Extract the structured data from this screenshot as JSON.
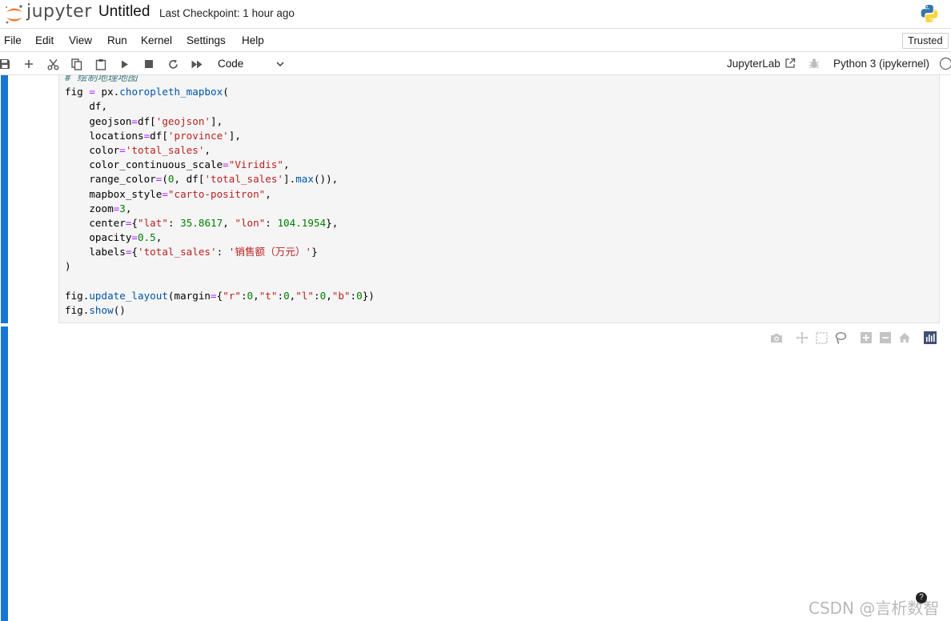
{
  "header": {
    "brand": "jupyter",
    "notebook_title": "Untitled",
    "checkpoint": "Last Checkpoint: 1 hour ago",
    "logo_icon": "jupyter-logo-icon",
    "kernel_logo_icon": "python-logo-icon"
  },
  "menubar": {
    "items": [
      "File",
      "Edit",
      "View",
      "Run",
      "Kernel",
      "Settings",
      "Help"
    ],
    "trusted": "Trusted"
  },
  "toolbar": {
    "icons": [
      "save-icon",
      "add-cell-icon",
      "cut-icon",
      "copy-icon",
      "paste-icon",
      "run-icon",
      "stop-icon",
      "restart-icon",
      "run-all-icon"
    ],
    "cell_type": "Code",
    "jupyterlab_link": "JupyterLab",
    "kernel_name": "Python 3 (ipykernel)"
  },
  "code_cell": {
    "lines": [
      "# 绘制地理地图",
      "fig = px.choropleth_mapbox(",
      "    df,",
      "    geojson=df['geojson'],",
      "    locations=df['province'],",
      "    color='total_sales',",
      "    color_continuous_scale=\"Viridis\",",
      "    range_color=(0, df['total_sales'].max()),",
      "    mapbox_style=\"carto-positron\",",
      "    zoom=3,",
      "    center={\"lat\": 35.8617, \"lon\": 104.1954},",
      "    opacity=0.5,",
      "    labels={'total_sales': '销售额（万元）'}",
      ")",
      "",
      "fig.update_layout(margin={\"r\":0,\"t\":0,\"l\":0,\"b\":0})",
      "fig.show()"
    ]
  },
  "output_modebar": {
    "icons": [
      "camera-icon",
      "pan-icon",
      "box-select-icon",
      "lasso-select-icon",
      "zoom-in-icon",
      "zoom-out-icon",
      "reset-home-icon",
      "plotly-logo-icon"
    ]
  },
  "watermark": "CSDN @言析数智",
  "colors": {
    "cell_active_bar": "#1976d2",
    "code_background": "#f5f5f5",
    "comment": "#3d7b7b",
    "string": "#ba2121",
    "number": "#008000",
    "operator": "#aa22ff"
  }
}
